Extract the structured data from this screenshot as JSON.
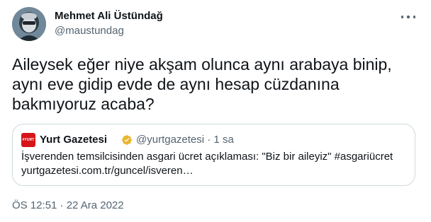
{
  "author": {
    "name": "Mehmet Ali Üstündağ",
    "handle": "@maustundag"
  },
  "tweet": {
    "text": "Aileysek eğer niye akşam olunca aynı arabaya binip,\naynı eve gidip evde de aynı hesap cüzdanına\nbakmıyoruz acaba?"
  },
  "quoted_tweet": {
    "logo_text": "#YURT",
    "name": "Yurt Gazetesi",
    "meta": "@yurtgazetesi · 1 sa",
    "body": "İşverenden temsilcisinden asgari ücret açıklaması: \"Biz bir aileyiz\" #asgariücret\nyurtgazetesi.com.tr/guncel/isveren…"
  },
  "timestamp": "ÖS 12:51 · 22 Ara 2022",
  "colors": {
    "text": "#0f1419",
    "secondary": "#536471",
    "border": "#cfd9de",
    "verified_gold": "#e8b52e",
    "logo_red": "#d7141a"
  },
  "icons": {
    "more": "more-horizontal-icon",
    "verified": "verified-badge-icon"
  }
}
